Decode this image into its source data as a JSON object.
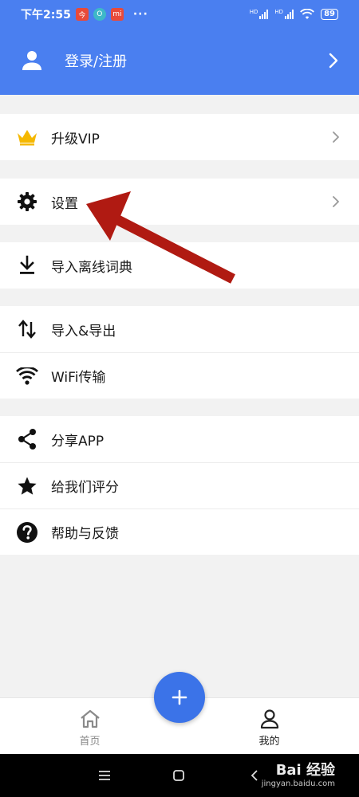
{
  "status_bar": {
    "time": "下午2:55",
    "app_badges": [
      "今",
      "O",
      "mi"
    ],
    "overflow": "···",
    "network_label": "HD",
    "battery": "89"
  },
  "header": {
    "login_label": "登录/注册",
    "icon": "user-icon"
  },
  "menu": {
    "vip": {
      "label": "升级VIP",
      "icon": "crown-icon",
      "icon_color": "#f5b800"
    },
    "settings": {
      "label": "设置",
      "icon": "gear-icon"
    },
    "offline_dict": {
      "label": "导入离线词典",
      "icon": "download-icon"
    },
    "import_export": {
      "label": "导入&导出",
      "icon": "swap-vertical-icon"
    },
    "wifi": {
      "label": "WiFi传输",
      "icon": "wifi-icon"
    },
    "share": {
      "label": "分享APP",
      "icon": "share-icon"
    },
    "rate": {
      "label": "给我们评分",
      "icon": "star-icon"
    },
    "help": {
      "label": "帮助与反馈",
      "icon": "help-icon"
    }
  },
  "bottom_nav": {
    "home": {
      "label": "首页",
      "icon": "home-icon"
    },
    "mine": {
      "label": "我的",
      "icon": "person-icon"
    }
  },
  "watermark": {
    "main": "Bai 经验",
    "sub": "jingyan.baidu.com"
  },
  "colors": {
    "header_bg": "#4a7ff0",
    "fab_bg": "#3b73e8",
    "arrow": "#b01a12",
    "crown": "#f5b800"
  }
}
